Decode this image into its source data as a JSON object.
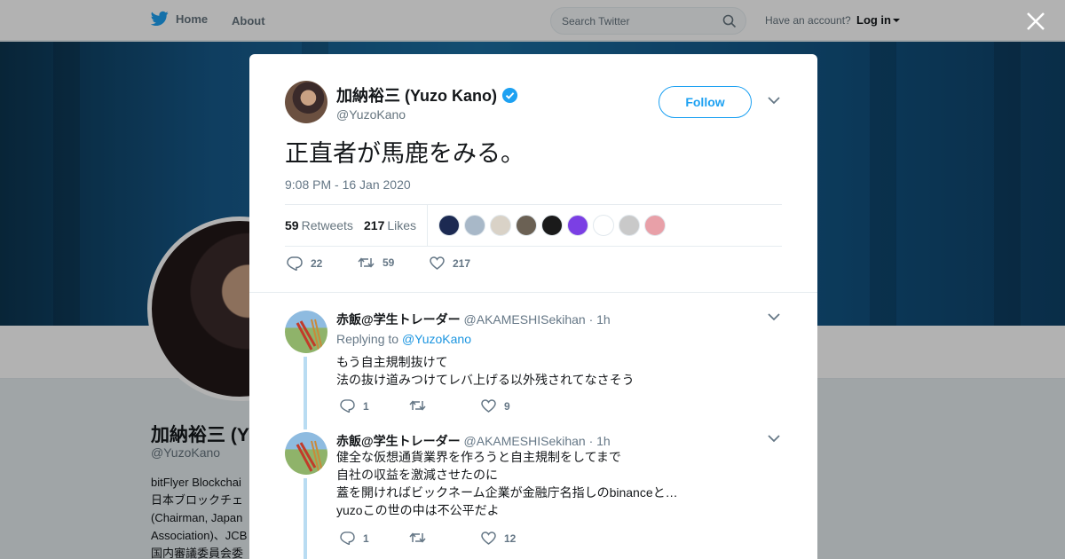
{
  "nav": {
    "home_label": "Home",
    "about_label": "About",
    "search_placeholder": "Search Twitter",
    "account_text": "Have an account?",
    "login_label": "Log in",
    "brand_color": "#1da1f2"
  },
  "background_profile": {
    "name": "加納裕三 (Y",
    "handle": "@YuzoKano",
    "bio_lines": [
      "bitFlyer Blockchai",
      "日本ブロックチェ",
      "(Chairman, Japan",
      "Association)、JCB",
      "国内審議委員会委"
    ]
  },
  "tweet": {
    "author_name": "加納裕三 (Yuzo Kano)",
    "author_handle": "@YuzoKano",
    "verified": true,
    "follow_label": "Follow",
    "text": "正直者が馬鹿をみる。",
    "timestamp": "9:08 PM - 16 Jan 2020",
    "retweets_count": "59",
    "retweets_label": "Retweets",
    "likes_count": "217",
    "likes_label": "Likes",
    "reply_count": "22",
    "retweet_count": "59",
    "like_count": "217",
    "liker_avatar_colors": [
      "#1c2a52",
      "#a8b8c8",
      "#d9d2c7",
      "#6b6154",
      "#1a1a1a",
      "#7b3fe4",
      "#ffffff",
      "#c9c9c9",
      "#e8a0a8"
    ]
  },
  "replies": [
    {
      "name": "赤飯@学生トレーダー",
      "handle": "@AKAMESHISekihan",
      "time": "· 1h",
      "replying_prefix": "Replying to",
      "replying_to": "@YuzoKano",
      "lines": [
        "もう自主規制抜けて",
        "法の抜け道みつけてレバ上げる以外残されてなさそう"
      ],
      "reply_count": "1",
      "retweet_count": "",
      "like_count": "9"
    },
    {
      "name": "赤飯@学生トレーダー",
      "handle": "@AKAMESHISekihan",
      "time": "· 1h",
      "lines": [
        "健全な仮想通貨業界を作ろうと自主規制をしてまで",
        "自社の収益を激減させたのに",
        "蓋を開ければビックネーム企業が金融庁名指しのbinanceと…",
        "yuzoこの世の中は不公平だよ"
      ],
      "reply_count": "1",
      "retweet_count": "",
      "like_count": "12"
    }
  ]
}
